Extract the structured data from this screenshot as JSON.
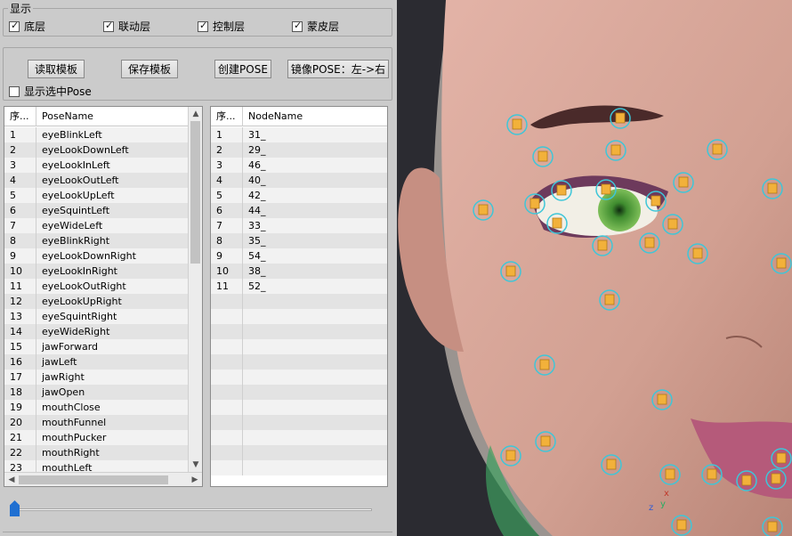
{
  "display": {
    "legend": "显示",
    "checkboxes": [
      {
        "label": "底层",
        "checked": true
      },
      {
        "label": "联动层",
        "checked": true
      },
      {
        "label": "控制层",
        "checked": true
      },
      {
        "label": "蒙皮层",
        "checked": true
      }
    ]
  },
  "toolbar": {
    "load_template": "读取模板",
    "save_template": "保存模板",
    "create_pose": "创建POSE",
    "mirror_pose": "镜像POSE：左->右",
    "show_selected_pose": "显示选中Pose",
    "show_selected_checked": false
  },
  "pose_table": {
    "headers": [
      "序...",
      "PoseName"
    ],
    "rows": [
      [
        "1",
        "eyeBlinkLeft"
      ],
      [
        "2",
        "eyeLookDownLeft"
      ],
      [
        "3",
        "eyeLookInLeft"
      ],
      [
        "4",
        "eyeLookOutLeft"
      ],
      [
        "5",
        "eyeLookUpLeft"
      ],
      [
        "6",
        "eyeSquintLeft"
      ],
      [
        "7",
        "eyeWideLeft"
      ],
      [
        "8",
        "eyeBlinkRight"
      ],
      [
        "9",
        "eyeLookDownRight"
      ],
      [
        "10",
        "eyeLookInRight"
      ],
      [
        "11",
        "eyeLookOutRight"
      ],
      [
        "12",
        "eyeLookUpRight"
      ],
      [
        "13",
        "eyeSquintRight"
      ],
      [
        "14",
        "eyeWideRight"
      ],
      [
        "15",
        "jawForward"
      ],
      [
        "16",
        "jawLeft"
      ],
      [
        "17",
        "jawRight"
      ],
      [
        "18",
        "jawOpen"
      ],
      [
        "19",
        "mouthClose"
      ],
      [
        "20",
        "mouthFunnel"
      ],
      [
        "21",
        "mouthPucker"
      ],
      [
        "22",
        "mouthRight"
      ],
      [
        "23",
        "mouthLeft"
      ]
    ]
  },
  "node_table": {
    "headers": [
      "序...",
      "NodeName"
    ],
    "rows": [
      [
        "1",
        "31_"
      ],
      [
        "2",
        "29_"
      ],
      [
        "3",
        "46_"
      ],
      [
        "4",
        "40_"
      ],
      [
        "5",
        "42_"
      ],
      [
        "6",
        "44_"
      ],
      [
        "7",
        "33_"
      ],
      [
        "8",
        "35_"
      ],
      [
        "9",
        "54_"
      ],
      [
        "10",
        "38_"
      ],
      [
        "11",
        "52_"
      ]
    ]
  },
  "slider": {
    "value": 0
  },
  "viewport": {
    "axis_x": "x",
    "axis_y": "y",
    "axis_z": "z",
    "colors": {
      "control_ring": "#3ec6d8",
      "control_fill": "#f2b13a",
      "skin": "#d8a79b",
      "hair": "#2a2a30"
    }
  }
}
